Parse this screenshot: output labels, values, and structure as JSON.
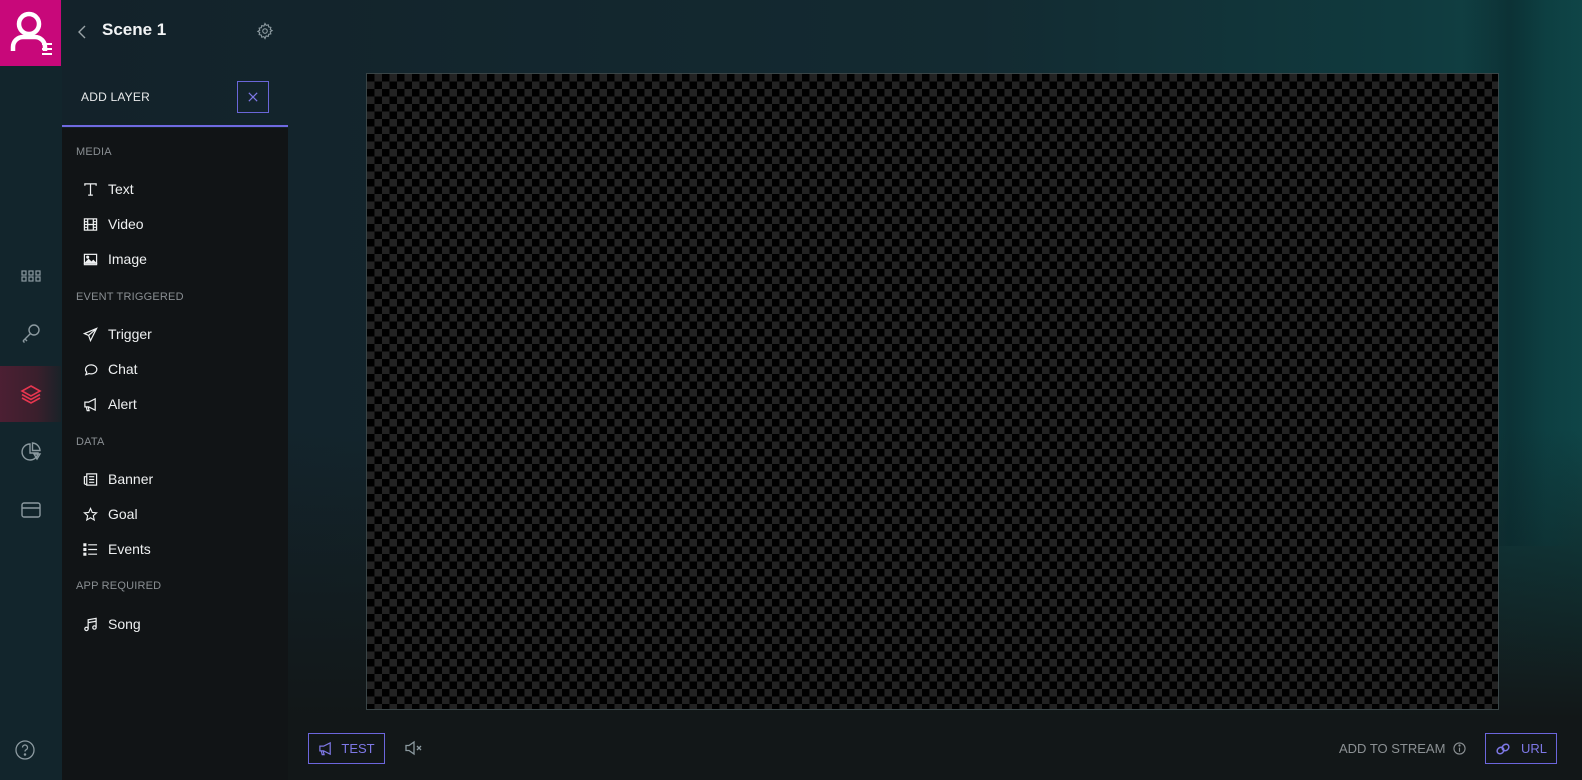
{
  "scene": {
    "title": "Scene 1"
  },
  "rail": {
    "items": [
      {
        "icon": "apps-grid-icon",
        "active": false
      },
      {
        "icon": "key-icon",
        "active": false
      },
      {
        "icon": "layers-icon",
        "active": true
      },
      {
        "icon": "pie-chart-icon",
        "active": false
      },
      {
        "icon": "card-icon",
        "active": false
      }
    ],
    "help_icon": "question-circle-icon"
  },
  "add_layer": {
    "title": "ADD LAYER",
    "sections": [
      {
        "label": "MEDIA",
        "items": [
          {
            "label": "Text",
            "icon": "text-icon"
          },
          {
            "label": "Video",
            "icon": "film-icon"
          },
          {
            "label": "Image",
            "icon": "image-icon"
          }
        ]
      },
      {
        "label": "EVENT TRIGGERED",
        "items": [
          {
            "label": "Trigger",
            "icon": "paper-plane-icon"
          },
          {
            "label": "Chat",
            "icon": "chat-bubble-icon"
          },
          {
            "label": "Alert",
            "icon": "megaphone-icon"
          }
        ]
      },
      {
        "label": "DATA",
        "items": [
          {
            "label": "Banner",
            "icon": "newspaper-icon"
          },
          {
            "label": "Goal",
            "icon": "star-icon"
          },
          {
            "label": "Events",
            "icon": "list-icon"
          }
        ]
      },
      {
        "label": "APP REQUIRED",
        "items": [
          {
            "label": "Song",
            "icon": "music-note-icon"
          }
        ]
      }
    ]
  },
  "footer": {
    "test_label": "TEST",
    "add_to_stream_label": "ADD TO STREAM",
    "url_label": "URL"
  },
  "colors": {
    "brand": "#c8087a",
    "accent": "#6c66dc",
    "active_icon": "#e8364f"
  }
}
